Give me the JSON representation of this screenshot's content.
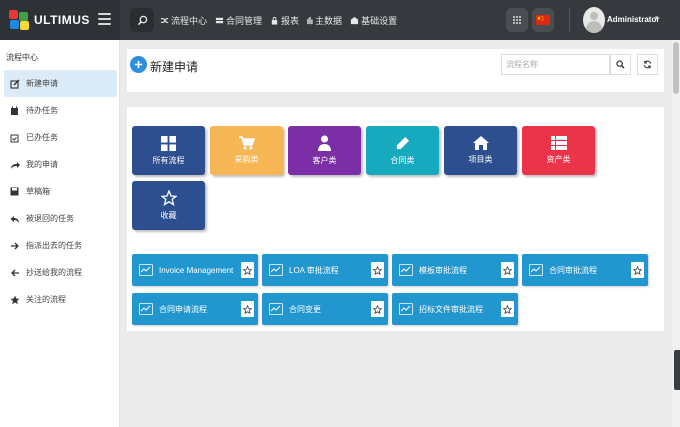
{
  "app": {
    "logo_text": "ULTIMUS",
    "logo_colors": [
      "#e53935",
      "#43a047",
      "#1e88e5",
      "#fdd835"
    ]
  },
  "topnav": [
    {
      "label": "流程中心",
      "icon": "shuffle-icon"
    },
    {
      "label": "合同管理",
      "icon": "contract-icon"
    },
    {
      "label": "报表",
      "icon": "lock-icon"
    },
    {
      "label": "主数据",
      "icon": "bars-icon"
    },
    {
      "label": "基础设置",
      "icon": "building-icon"
    }
  ],
  "user": {
    "name": "Administrator",
    "language": "zh-CN flag"
  },
  "sidebar": {
    "title": "流程中心",
    "items": [
      {
        "label": "新建申请",
        "icon": "edit-icon",
        "active": true
      },
      {
        "label": "待办任务",
        "icon": "calendar-icon",
        "active": false
      },
      {
        "label": "已办任务",
        "icon": "calendar-check-icon",
        "active": false
      },
      {
        "label": "我的申请",
        "icon": "share-icon",
        "active": false
      },
      {
        "label": "草稿箱",
        "icon": "save-icon",
        "active": false
      },
      {
        "label": "被退回的任务",
        "icon": "reply-icon",
        "active": false
      },
      {
        "label": "指派出去的任务",
        "icon": "arrow-right-icon",
        "active": false
      },
      {
        "label": "抄送给我的流程",
        "icon": "arrow-left-icon",
        "active": false
      },
      {
        "label": "关注的流程",
        "icon": "star-icon",
        "active": false
      }
    ]
  },
  "header": {
    "title": "新建申请",
    "search_placeholder": "流程名称"
  },
  "categories": [
    {
      "label": "所有流程",
      "color": "#2d4f8f",
      "icon": "grid-icon"
    },
    {
      "label": "采购类",
      "color": "#f6b655",
      "icon": "cart-icon"
    },
    {
      "label": "客户类",
      "color": "#7b2ea6",
      "icon": "user-icon"
    },
    {
      "label": "合同类",
      "color": "#17a9be",
      "icon": "pencil-icon"
    },
    {
      "label": "项目类",
      "color": "#2d4f8f",
      "icon": "home-icon"
    },
    {
      "label": "资产类",
      "color": "#eb3349",
      "icon": "list-icon"
    },
    {
      "label": "收藏",
      "color": "#2d4f8f",
      "icon": "star-outline-icon"
    }
  ],
  "flows": [
    {
      "label": "Invoice Management"
    },
    {
      "label": "LOA 审批流程"
    },
    {
      "label": "模板审批流程"
    },
    {
      "label": "合同审批流程"
    },
    {
      "label": "合同申请流程"
    },
    {
      "label": "合同变更"
    },
    {
      "label": "招标文件审批流程"
    }
  ]
}
